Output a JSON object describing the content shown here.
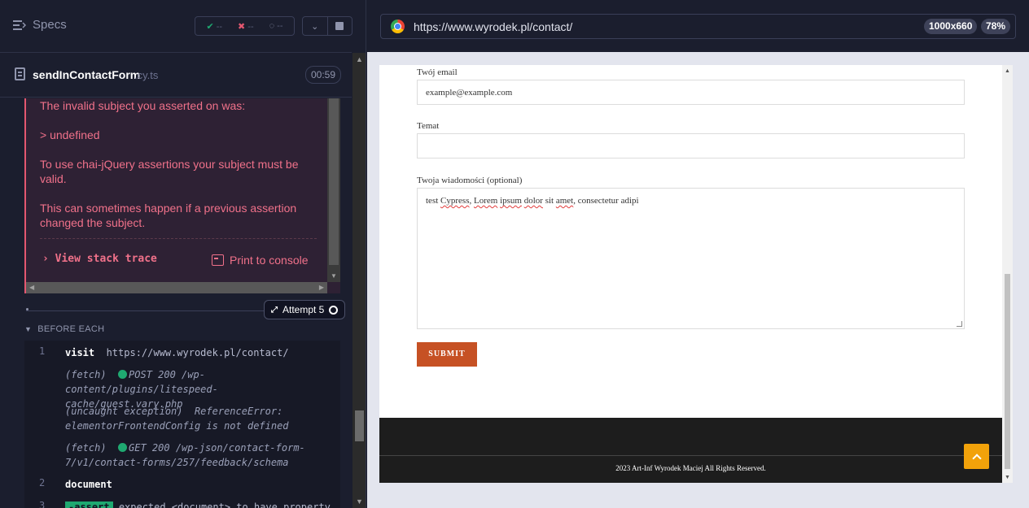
{
  "reporter": {
    "specs_label": "Specs",
    "stats": {
      "passed": "--",
      "failed": "--",
      "pending": "--"
    },
    "spec_file": {
      "name": "sendInContactForm",
      "ext": ".cy.ts",
      "duration": "00:59"
    },
    "error": {
      "lines": [
        "The invalid subject you asserted on was:",
        "> undefined",
        "To use chai-jQuery assertions your subject must be valid.",
        "This can sometimes happen if a previous assertion changed the subject."
      ],
      "stack_trace_label": "View stack trace",
      "print_console_label": "Print to console"
    },
    "attempt_label": "Attempt 5",
    "hook_label": "BEFORE EACH",
    "commands": [
      {
        "num": "1",
        "name": "visit",
        "message": "https://www.wyrodek.pl/contact/"
      },
      {
        "num": "",
        "name": "(fetch)",
        "message": "POST 200 /wp-content/plugins/litespeed-cache/guest.vary.php"
      },
      {
        "num": "",
        "name": "(uncaught exception)",
        "message": "ReferenceError: elementorFrontendConfig is not defined"
      },
      {
        "num": "",
        "name": "(fetch)",
        "message": "GET 200 /wp-json/contact-form-7/v1/contact-forms/257/feedback/schema"
      },
      {
        "num": "2",
        "name": "document",
        "message": ""
      },
      {
        "num": "3",
        "name": "-assert",
        "message": "expected <document> to have property"
      }
    ]
  },
  "browser": {
    "url": "https://www.wyrodek.pl/contact/",
    "viewport": "1000x660",
    "zoom": "78%"
  },
  "contact_form": {
    "email_label": "Twój email",
    "email_value": "example@example.com",
    "subject_label": "Temat",
    "subject_value": "",
    "message_label": "Twoja wiadomości (optional)",
    "message_words": [
      "test",
      "Cypress",
      ", ",
      "Lorem",
      "ipsum",
      "dolor",
      "sit",
      "amet",
      ", consectetur adipi"
    ],
    "submit_label": "SUBMIT",
    "footer_text": "2023 Art-Inf Wyrodek Maciej All Rights Reserved."
  },
  "colors": {
    "error": "#f0718a",
    "success": "#1fa971",
    "submit": "#c65124",
    "scroll_top": "#f2a20a"
  }
}
